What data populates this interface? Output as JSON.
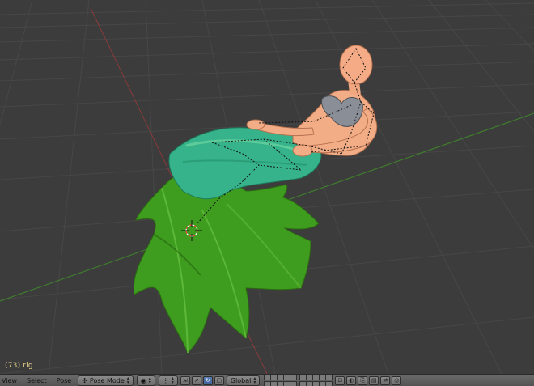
{
  "viewport": {
    "object_info": "(73) rig"
  },
  "header": {
    "menus": [
      "View",
      "Select",
      "Pose"
    ],
    "mode_label": "Pose Mode",
    "orientation_label": "Global",
    "icons": [
      "viewport-shading-icon",
      "pivot-point-icon",
      "manipulator-toggle-icon",
      "translate-icon",
      "rotate-icon",
      "scale-icon",
      "lock-icon",
      "render-icon",
      "copy-pose-icon",
      "paste-pose-icon",
      "paste-flipped-pose-icon",
      "proportional-edit-icon"
    ]
  }
}
